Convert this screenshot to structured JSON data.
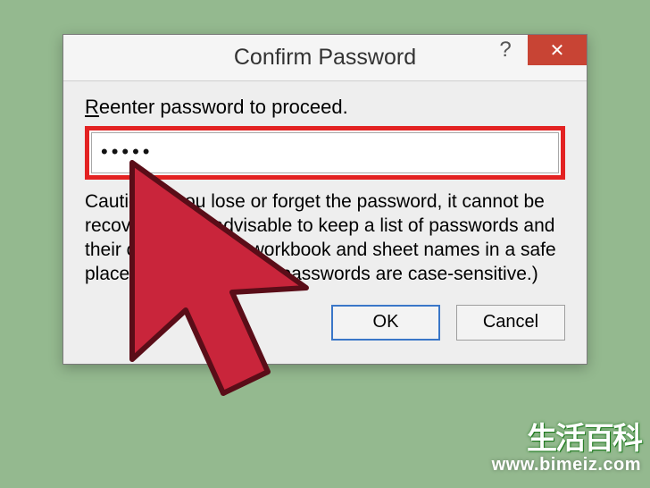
{
  "dialog": {
    "title": "Confirm Password",
    "help_symbol": "?",
    "close_symbol": "✕",
    "prompt_prefix": "R",
    "prompt_rest": "eenter password to proceed.",
    "password_masked": "•••••",
    "caution": "Caution: If you lose or forget the password, it cannot be recovered. It is advisable to keep a list of passwords and their corresponding workbook and sheet names in a safe place.  (Remember that passwords are case-sensitive.)",
    "ok_label": "OK",
    "cancel_label": "Cancel"
  },
  "watermark": {
    "logo_text": "生活百科",
    "url": "www.bimeiz.com"
  }
}
